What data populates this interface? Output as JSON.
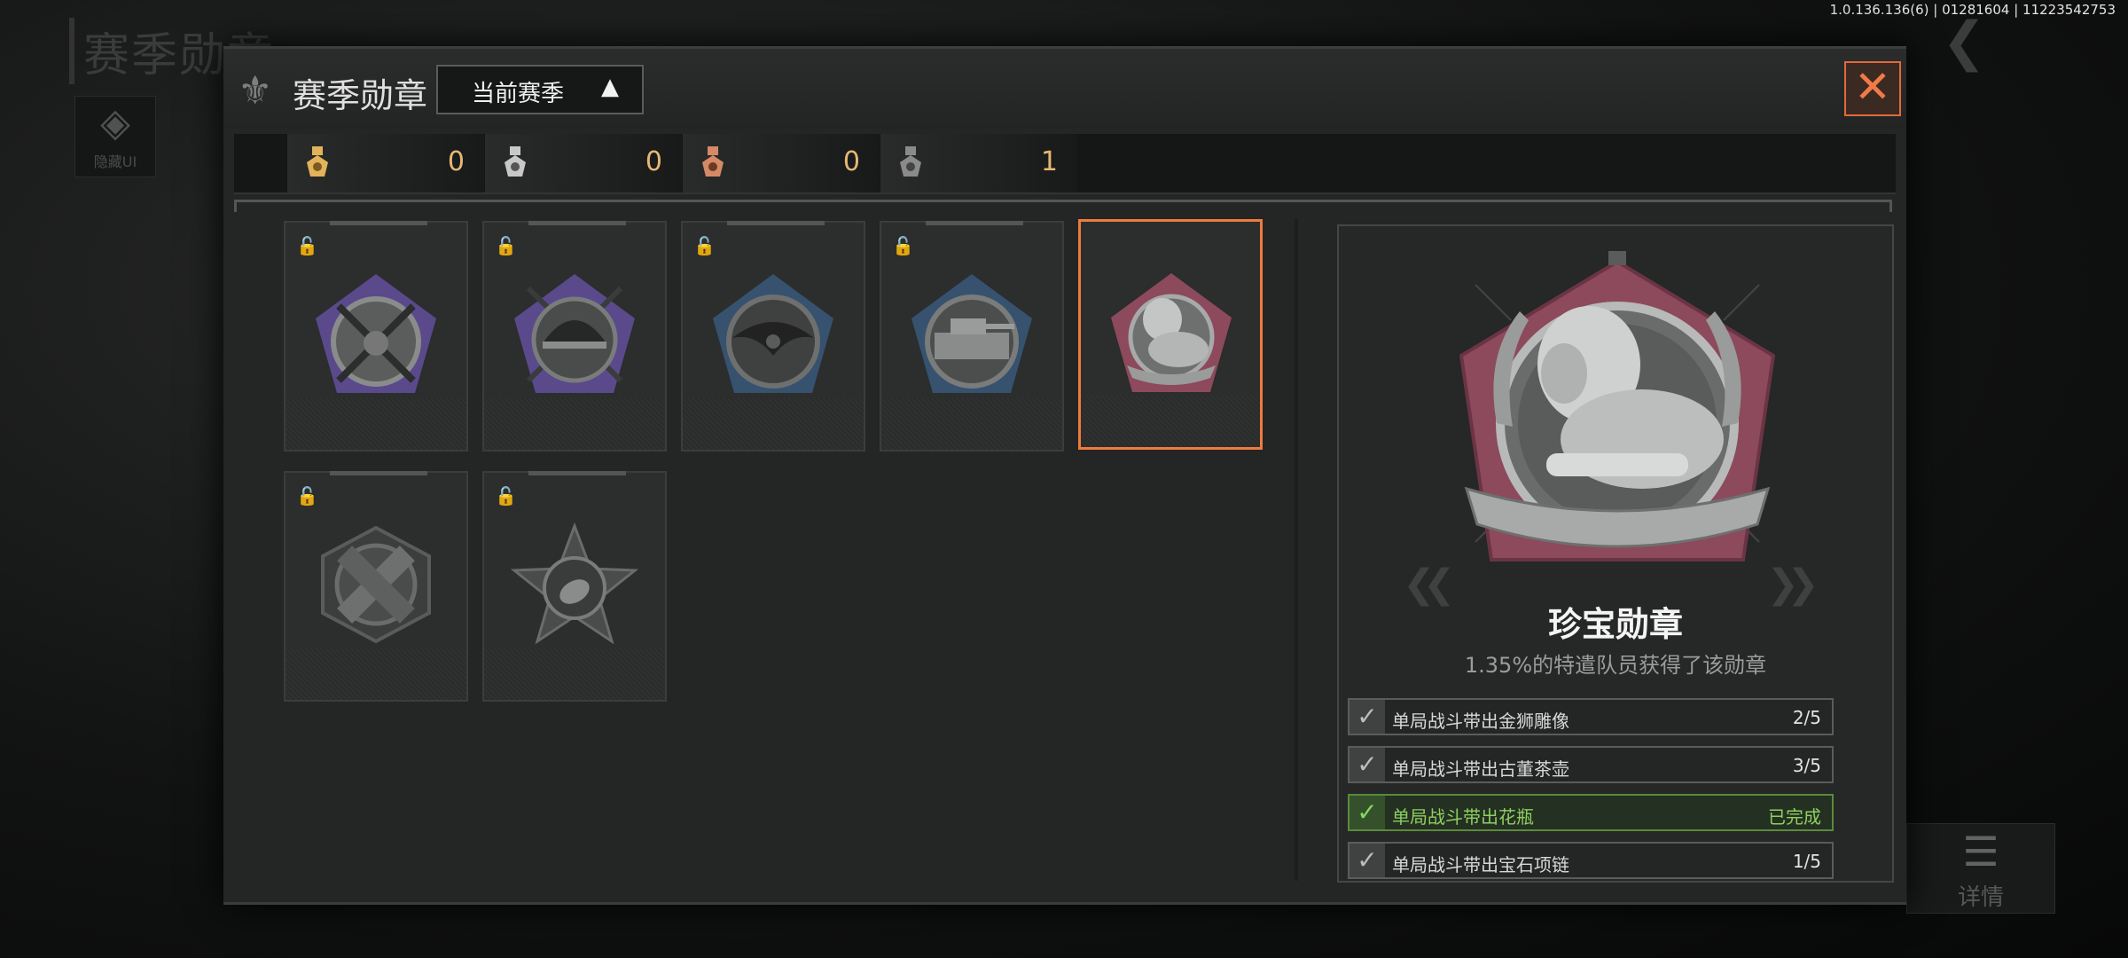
{
  "background": {
    "title": "赛季勋章",
    "hide_ui_label": "隐藏UI",
    "version": "1.0.136.136(6) | 01281604 | 11223542753",
    "detail_label": "详情"
  },
  "header": {
    "title": "赛季勋章",
    "season_select": "当前赛季"
  },
  "colors": {
    "accent_orange": "#ee7b3c",
    "gold": "#e7b873",
    "complete_green": "#8fcf5f"
  },
  "rank_counts": [
    {
      "icon": "gold-rank-icon",
      "color": "#e2b35a",
      "count": "0"
    },
    {
      "icon": "silver-rank-icon",
      "color": "#c8c8c8",
      "count": "0"
    },
    {
      "icon": "bronze-rank-icon",
      "color": "#d48a66",
      "count": "0"
    },
    {
      "icon": "gray-rank-icon",
      "color": "#8a8a8a",
      "count": "1"
    }
  ],
  "medals": [
    {
      "icon": "crossed-rifles-medal-icon",
      "locked": true,
      "color": "#5a4a8c"
    },
    {
      "icon": "helmet-medal-icon",
      "locked": true,
      "color": "#5a4a8c"
    },
    {
      "icon": "eagle-medal-icon",
      "locked": true,
      "color": "#36526e"
    },
    {
      "icon": "tank-medal-icon",
      "locked": true,
      "color": "#36526e"
    },
    {
      "icon": "lion-medal-icon",
      "locked": false,
      "selected": true,
      "color": "#8c4a5c"
    },
    {
      "icon": "crossed-bars-medal-icon",
      "locked": true,
      "color": "#4a4b4b"
    },
    {
      "icon": "grenade-star-medal-icon",
      "locked": true,
      "color": "#4a4b4b"
    }
  ],
  "detail": {
    "name": "珍宝勋章",
    "rate_text": "1.35%的特遣队员获得了该勋章",
    "tasks": [
      {
        "label": "单局战斗带出金狮雕像",
        "progress": "2/5",
        "done": false
      },
      {
        "label": "单局战斗带出古董茶壶",
        "progress": "3/5",
        "done": false
      },
      {
        "label": "单局战斗带出花瓶",
        "progress": "已完成",
        "done": true
      },
      {
        "label": "单局战斗带出宝石项链",
        "progress": "1/5",
        "done": false
      }
    ]
  }
}
